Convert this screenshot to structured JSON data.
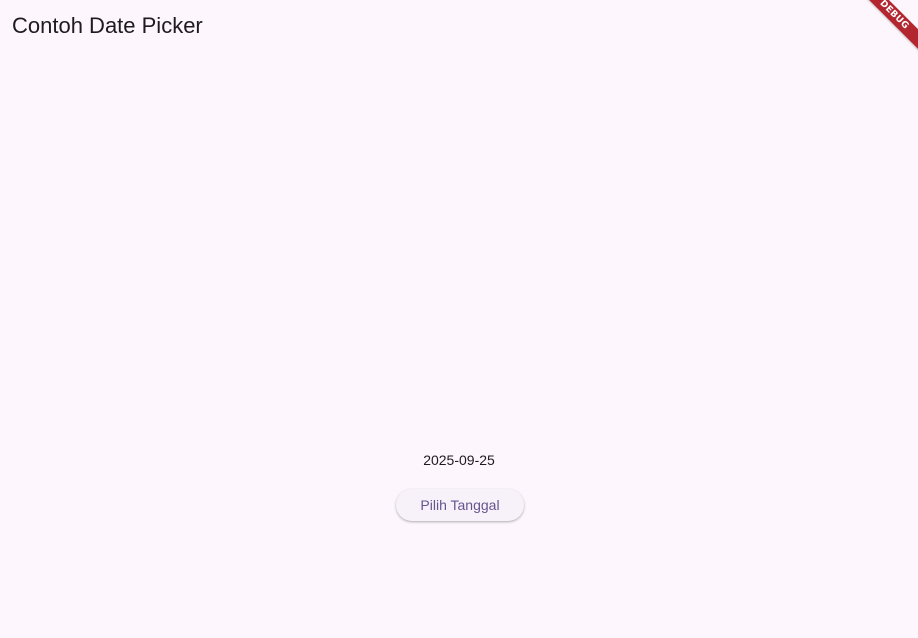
{
  "app_bar": {
    "title": "Contoh Date Picker"
  },
  "debug_banner": {
    "label": "DEBUG",
    "color": "#b3262f"
  },
  "main": {
    "selected_date": "2025-09-25",
    "pick_date_button_label": "Pilih Tanggal"
  },
  "colors": {
    "background": "#fdf7fd",
    "primary": "#65558f",
    "text": "#1d1b20"
  }
}
